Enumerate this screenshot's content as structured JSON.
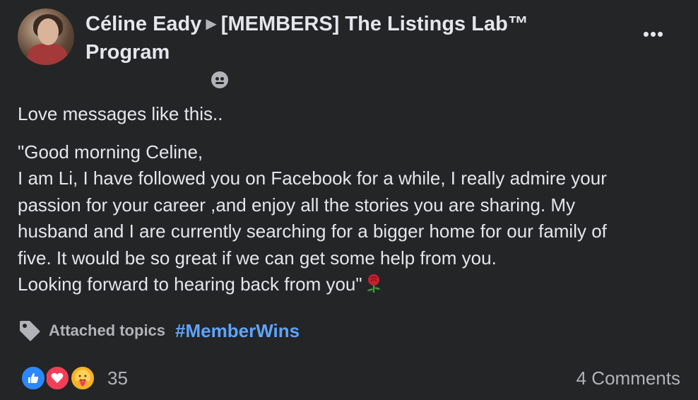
{
  "post": {
    "author": "Céline Eady",
    "group": "[MEMBERS] The Listings Lab™ Program",
    "privacy_icon": "members-group-icon",
    "more_label": "•••",
    "intro": "Love messages like this..",
    "message_lines": [
      "\"Good morning Celine,",
      "I am Li, I have followed you on Facebook for a while, I really admire your",
      "passion for your career ,and enjoy all the stories you are sharing. My",
      "husband and I are currently searching for a bigger home for our family of",
      "five. It would be so great if we can get some help from you.",
      "Looking forward to hearing back from you\""
    ],
    "emoji": "rose-icon"
  },
  "topics": {
    "label": "Attached topics",
    "tag": "#MemberWins"
  },
  "footer": {
    "reaction_count": "35",
    "comments": "4 Comments",
    "reactions": [
      "like",
      "love",
      "care"
    ]
  },
  "colors": {
    "background": "#242526",
    "text": "#e4e6eb",
    "secondary": "#b0b3b8",
    "link": "#5ea4ff",
    "like": "#2d88ff",
    "love": "#f33e58",
    "care": "#f7b125"
  }
}
